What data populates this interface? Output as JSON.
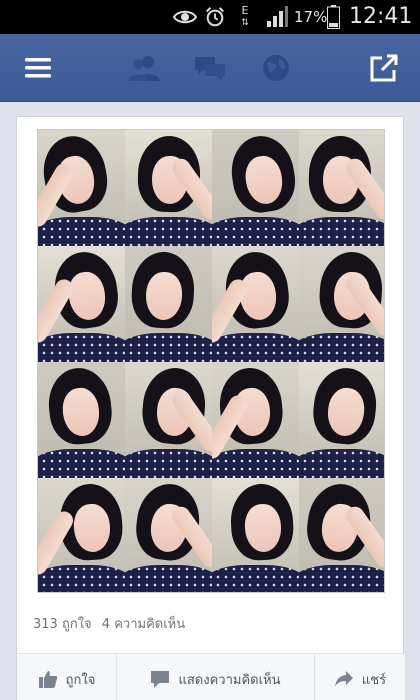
{
  "status_bar": {
    "network_label": "E",
    "battery_percent": "17%",
    "time": "12:41",
    "icons": [
      "eye-icon",
      "alarm-icon",
      "data-arrows-icon",
      "signal-icon",
      "battery-icon"
    ]
  },
  "top_bar": {
    "color": "#3b5998",
    "icons": [
      "menu-icon",
      "friend-requests-icon",
      "messages-icon",
      "notifications-globe-icon",
      "share-external-icon"
    ]
  },
  "post": {
    "stats": {
      "likes": "313 ถูกใจ",
      "comments": "4 ความคิดเห็น"
    },
    "photo": {
      "layout": "4x4 selfie collage"
    },
    "actions": {
      "like_label": "ถูกใจ",
      "comment_label": "แสดงความคิดเห็น",
      "share_label": "แชร์"
    }
  }
}
